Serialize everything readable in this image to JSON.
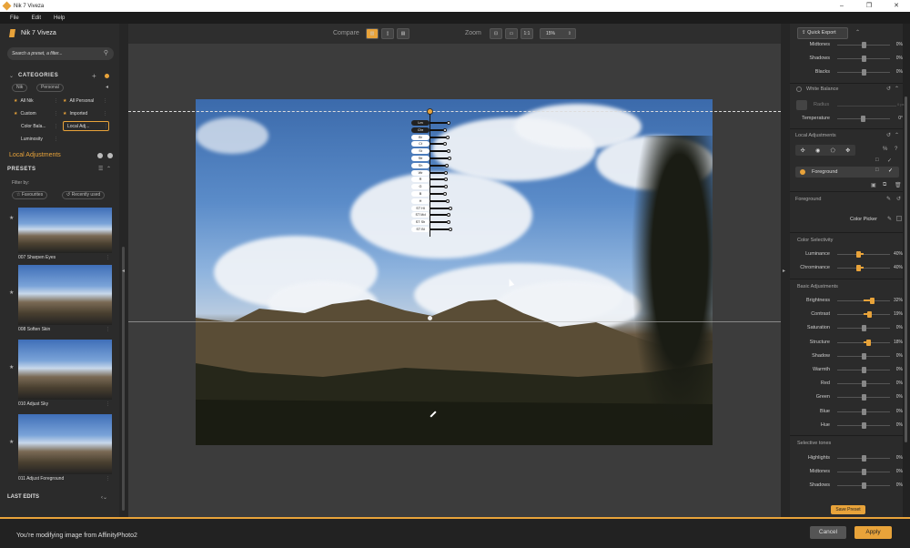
{
  "window": {
    "title": "Nik 7 Viveza",
    "min": "–",
    "max": "❐",
    "close": "✕"
  },
  "menu": [
    "File",
    "Edit",
    "Help"
  ],
  "left": {
    "brand": "Nik 7 Viveza",
    "search_placeholder": "Search a preset, a filter...",
    "categories_title": "CATEGORIES",
    "tags": [
      "Nik",
      "Personal"
    ],
    "categories": [
      {
        "label": "All Nik",
        "star": true
      },
      {
        "label": "All Personal",
        "star": true
      },
      {
        "label": "Custom",
        "star": true
      },
      {
        "label": "Imported",
        "star": true
      },
      {
        "label": "Color Bala...",
        "star": false
      },
      {
        "label": "Local Adj...",
        "star": false
      },
      {
        "label": "Luminosity",
        "star": false
      }
    ],
    "local_adjustments": "Local Adjustments",
    "presets_title": "PRESETS",
    "filter_by": "Filter by:",
    "filters": [
      "Favourites",
      "Recently used"
    ],
    "presets": [
      "007 Sharpen Eyes",
      "008 Soften Skin",
      "010 Adjust Sky",
      "011 Adjust Foreground"
    ],
    "last_edits": "LAST EDITS"
  },
  "toolbar": {
    "compare": "Compare",
    "zoom": "Zoom",
    "one_to_one": "1:1",
    "zoom_value": "15%"
  },
  "control_point": {
    "labels": [
      "Lm",
      "Chr",
      "Br",
      "Ct",
      "St",
      "Str",
      "Sh",
      "Wr",
      "R",
      "G",
      "B",
      "H",
      "ST Hl",
      "ST Md",
      "ST Sh",
      "ST Bl"
    ]
  },
  "right": {
    "quick_export": "Quick Export",
    "top_rows": [
      {
        "label": "Midtones",
        "value": "0%"
      },
      {
        "label": "Shadows",
        "value": "0%"
      },
      {
        "label": "Blacks",
        "value": "0%"
      }
    ],
    "white_balance": "White Balance",
    "radius": "Radius",
    "radius_unit": "0 px",
    "temperature": "Temperature",
    "temperature_value": "0°",
    "local_adjustments": "Local Adjustments",
    "foreground_item": "Foreground",
    "foreground_label": "Foreground",
    "color_picker": "Color Picker",
    "color_selectivity": "Color Selectivity",
    "selectivity_rows": [
      {
        "label": "Luminance",
        "value": "40%",
        "pos": 0.4,
        "accent": true
      },
      {
        "label": "Chrominance",
        "value": "40%",
        "pos": 0.4,
        "accent": true
      }
    ],
    "basic_adjustments": "Basic Adjustments",
    "basic_rows": [
      {
        "label": "Brightness",
        "value": "32%",
        "pos": 0.66,
        "accent": true
      },
      {
        "label": "Contrast",
        "value": "19%",
        "pos": 0.6,
        "accent": true
      },
      {
        "label": "Saturation",
        "value": "0%",
        "pos": 0.5,
        "accent": false
      },
      {
        "label": "Structure",
        "value": "18%",
        "pos": 0.59,
        "accent": true
      },
      {
        "label": "Shadow",
        "value": "0%",
        "pos": 0.5,
        "accent": false
      },
      {
        "label": "Warmth",
        "value": "0%",
        "pos": 0.5,
        "accent": false
      },
      {
        "label": "Red",
        "value": "0%",
        "pos": 0.5,
        "accent": false
      },
      {
        "label": "Green",
        "value": "0%",
        "pos": 0.5,
        "accent": false
      },
      {
        "label": "Blue",
        "value": "0%",
        "pos": 0.5,
        "accent": false
      },
      {
        "label": "Hue",
        "value": "0%",
        "pos": 0.5,
        "accent": false
      }
    ],
    "selective_tones": "Selective tones",
    "tone_rows": [
      {
        "label": "Highlights",
        "value": "0%"
      },
      {
        "label": "Midtones",
        "value": "0%"
      },
      {
        "label": "Shadows",
        "value": "0%"
      }
    ],
    "save_preset": "Save Preset"
  },
  "status": {
    "message": "You're modifying image from AffinityPhoto2",
    "cancel": "Cancel",
    "apply": "Apply"
  },
  "colors": {
    "accent": "#e8a33a",
    "panel": "#2b2b2b"
  }
}
